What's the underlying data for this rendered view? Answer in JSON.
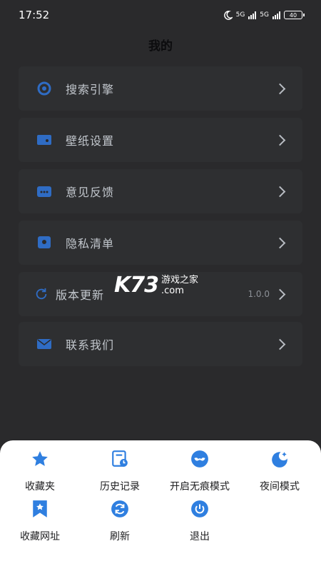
{
  "status_bar": {
    "time": "17:52",
    "network_1": "5G",
    "network_2": "5G",
    "battery": "40"
  },
  "page": {
    "title": "我的"
  },
  "menu": {
    "items": [
      {
        "label": "搜索引擎",
        "icon": "search-engine-icon"
      },
      {
        "label": "壁纸设置",
        "icon": "wallpaper-icon"
      },
      {
        "label": "意见反馈",
        "icon": "feedback-icon"
      },
      {
        "label": "隐私清单",
        "icon": "privacy-icon"
      },
      {
        "label": "版本更新",
        "icon": "refresh-icon",
        "value": "1.0.0"
      },
      {
        "label": "联系我们",
        "icon": "mail-icon"
      }
    ]
  },
  "watermark": {
    "logo": "K73",
    "line1": "游戏之家",
    "line2": ".com"
  },
  "sheet": {
    "items": [
      {
        "label": "收藏夹",
        "icon": "star-icon"
      },
      {
        "label": "历史记录",
        "icon": "history-icon"
      },
      {
        "label": "开启无痕模式",
        "icon": "incognito-mask-icon"
      },
      {
        "label": "夜间模式",
        "icon": "moon-icon"
      },
      {
        "label": "收藏网址",
        "icon": "bookmark-icon"
      },
      {
        "label": "刷新",
        "icon": "refresh-icon"
      },
      {
        "label": "退出",
        "icon": "power-icon"
      }
    ]
  },
  "colors": {
    "accent": "#2f7fe0",
    "overlay": "#2a2a2c",
    "sheet_bg": "#ffffff"
  }
}
